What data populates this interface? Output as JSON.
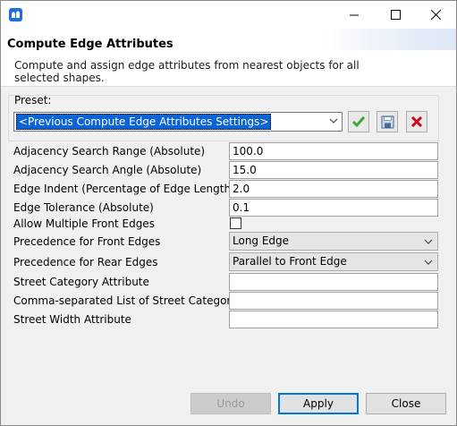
{
  "header": {
    "title": "Compute Edge Attributes",
    "description": "Compute and assign edge attributes from nearest objects for all selected shapes."
  },
  "preset": {
    "label": "Preset:",
    "selected": "<Previous Compute Edge Attributes Settings>"
  },
  "fields": [
    {
      "label": "Adjacency Search Range (Absolute)",
      "value": "100.0"
    },
    {
      "label": "Adjacency Search Angle (Absolute)",
      "value": "15.0"
    },
    {
      "label": "Edge Indent (Percentage of Edge Length)",
      "value": "2.0"
    },
    {
      "label": "Edge Tolerance (Absolute)",
      "value": "0.1"
    }
  ],
  "allow_multiple": {
    "label": "Allow Multiple Front Edges",
    "checked": false
  },
  "precedence_front": {
    "label": "Precedence for Front Edges",
    "value": "Long Edge"
  },
  "precedence_rear": {
    "label": "Precedence for Rear Edges",
    "value": "Parallel to Front Edge"
  },
  "street_fields": [
    {
      "label": "Street Category Attribute",
      "value": ""
    },
    {
      "label": "Comma-separated List of Street Categories",
      "value": ""
    },
    {
      "label": "Street Width Attribute",
      "value": ""
    }
  ],
  "buttons": {
    "undo": "Undo",
    "apply": "Apply",
    "close": "Close"
  },
  "colors": {
    "accent": "#0078d7",
    "selection": "#0a64d6",
    "save_ok": "#3aa63a",
    "delete": "#d0021b"
  }
}
